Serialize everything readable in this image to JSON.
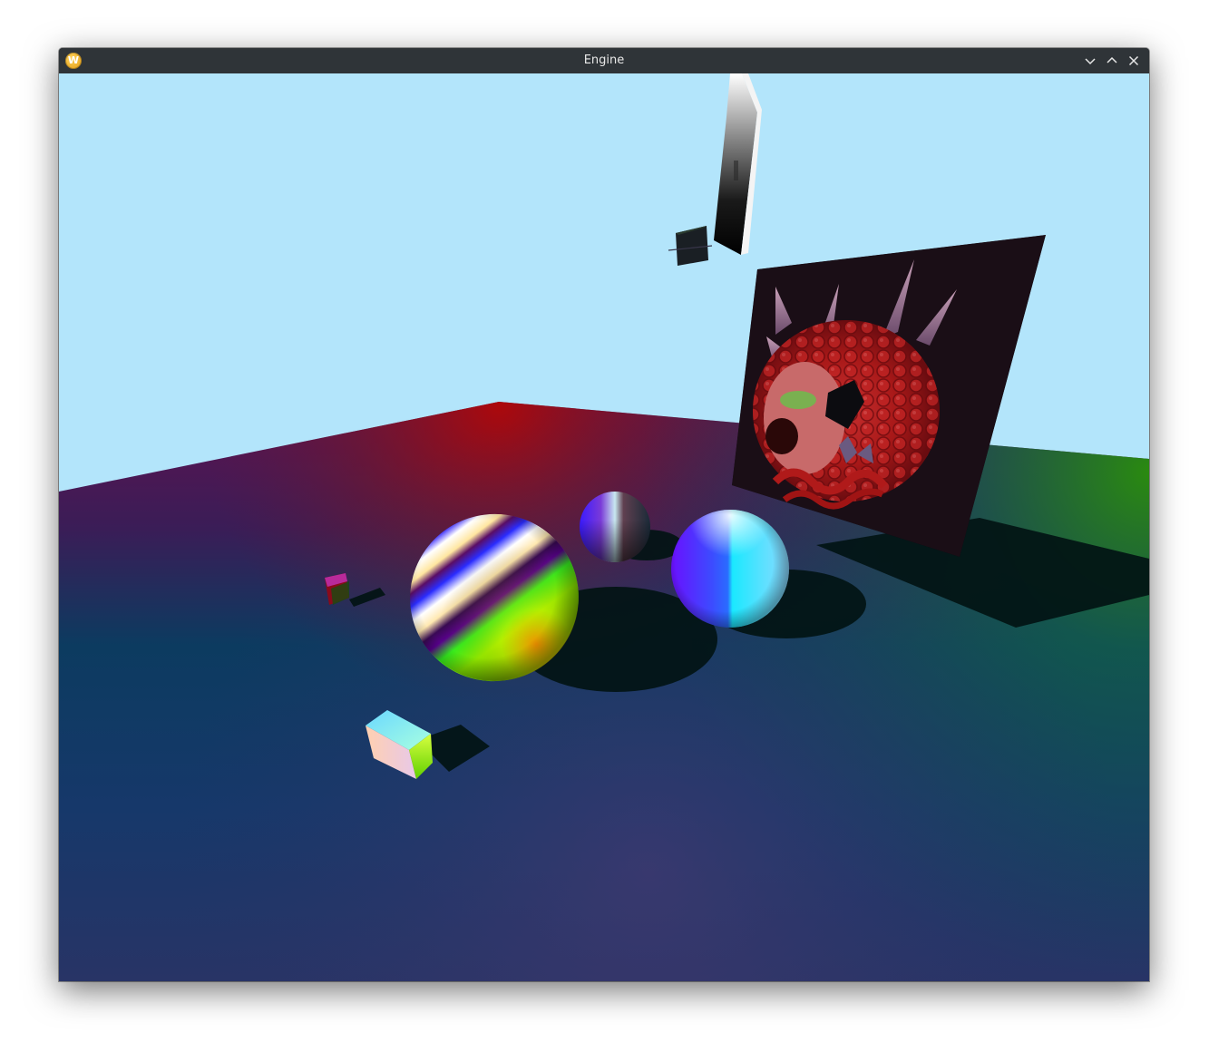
{
  "window": {
    "title": "Engine",
    "app_icon_letter": "W",
    "controls": [
      "minimize-icon",
      "maximize-icon",
      "close-icon"
    ]
  },
  "scene": {
    "sky_color": "#b3e5fb",
    "objects": [
      "floor-plane",
      "textured-wall-panel",
      "tall-gradient-panel",
      "small-dark-cube",
      "striped-sphere",
      "metallic-sphere",
      "blue-cyan-sphere",
      "small-rainbow-cube",
      "pastel-box"
    ]
  }
}
